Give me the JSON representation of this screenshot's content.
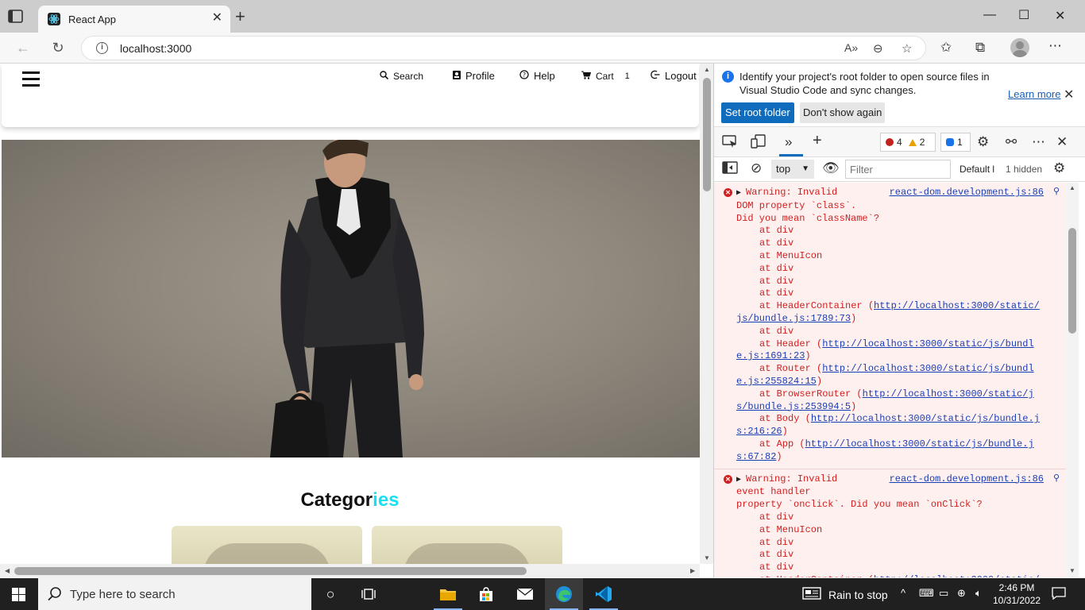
{
  "browser": {
    "tab_title": "React App",
    "url": "localhost:3000",
    "win_minimize": "—",
    "win_maximize": "☐",
    "win_close": "✕"
  },
  "site": {
    "nav": [
      {
        "label": "Search",
        "icon": "search-icon"
      },
      {
        "label": "Profile",
        "icon": "profile-icon"
      },
      {
        "label": "Help",
        "icon": "help-icon"
      },
      {
        "label": "Cart",
        "icon": "cart-icon",
        "count": "1"
      },
      {
        "label": "Logout",
        "icon": "logout-icon"
      }
    ],
    "categories_title_a": "Categor",
    "categories_title_b": "ies",
    "accent": "#18e0f0"
  },
  "devtools": {
    "info_message": "Identify your project's root folder to open source files in Visual Studio Code and sync changes.",
    "learn_more": "Learn more",
    "set_root": "Set root folder",
    "dont_show": "Don't show again",
    "errors": "4",
    "warnings": "2",
    "infos": "1",
    "context": "top",
    "filter_placeholder": "Filter",
    "levels": "Default l",
    "hidden": "1 hidden",
    "messages": [
      {
        "text_lines": [
          "Warning: Invalid",
          "DOM property `class`.",
          "Did you mean `className`?"
        ],
        "source": "react-dom.development.js:86",
        "frames": [
          {
            "t": "at div"
          },
          {
            "t": "at div"
          },
          {
            "t": "at MenuIcon"
          },
          {
            "t": "at div"
          },
          {
            "t": "at div"
          },
          {
            "t": "at div"
          },
          {
            "t": "at HeaderContainer (",
            "link1": "http://localhost:3000/static/",
            "link2": "js/bundle.js:1789:73",
            "end": ")"
          },
          {
            "t": "at div"
          },
          {
            "t": "at Header (",
            "link1": "http://localhost:3000/static/js/bundl",
            "link2": "e.js:1691:23",
            "end": ")"
          },
          {
            "t": "at Router (",
            "link1": "http://localhost:3000/static/js/bundl",
            "link2": "e.js:255824:15",
            "end": ")"
          },
          {
            "t": "at BrowserRouter (",
            "link1": "http://localhost:3000/static/j",
            "link2": "s/bundle.js:253994:5",
            "end": ")"
          },
          {
            "t": "at Body (",
            "link1": "http://localhost:3000/static/js/bundle.j",
            "link2": "s:216:26",
            "end": ")"
          },
          {
            "t": "at App (",
            "link1": "http://localhost:3000/static/js/bundle.j",
            "link2": "s:67:82",
            "end": ")"
          }
        ]
      },
      {
        "text_lines": [
          "Warning: Invalid",
          "event handler",
          "property `onclick`. Did you mean `onClick`?"
        ],
        "source": "react-dom.development.js:86",
        "frames": [
          {
            "t": "at div"
          },
          {
            "t": "at MenuIcon"
          },
          {
            "t": "at div"
          },
          {
            "t": "at div"
          },
          {
            "t": "at div"
          },
          {
            "t": "at HeaderContainer (",
            "link1": "http://localhost:3000/static/",
            "link2": "",
            "end": ""
          }
        ]
      }
    ]
  },
  "taskbar": {
    "search_placeholder": "Type here to search",
    "weather": "Rain to stop",
    "time": "2:46 PM",
    "date": "10/31/2022"
  }
}
